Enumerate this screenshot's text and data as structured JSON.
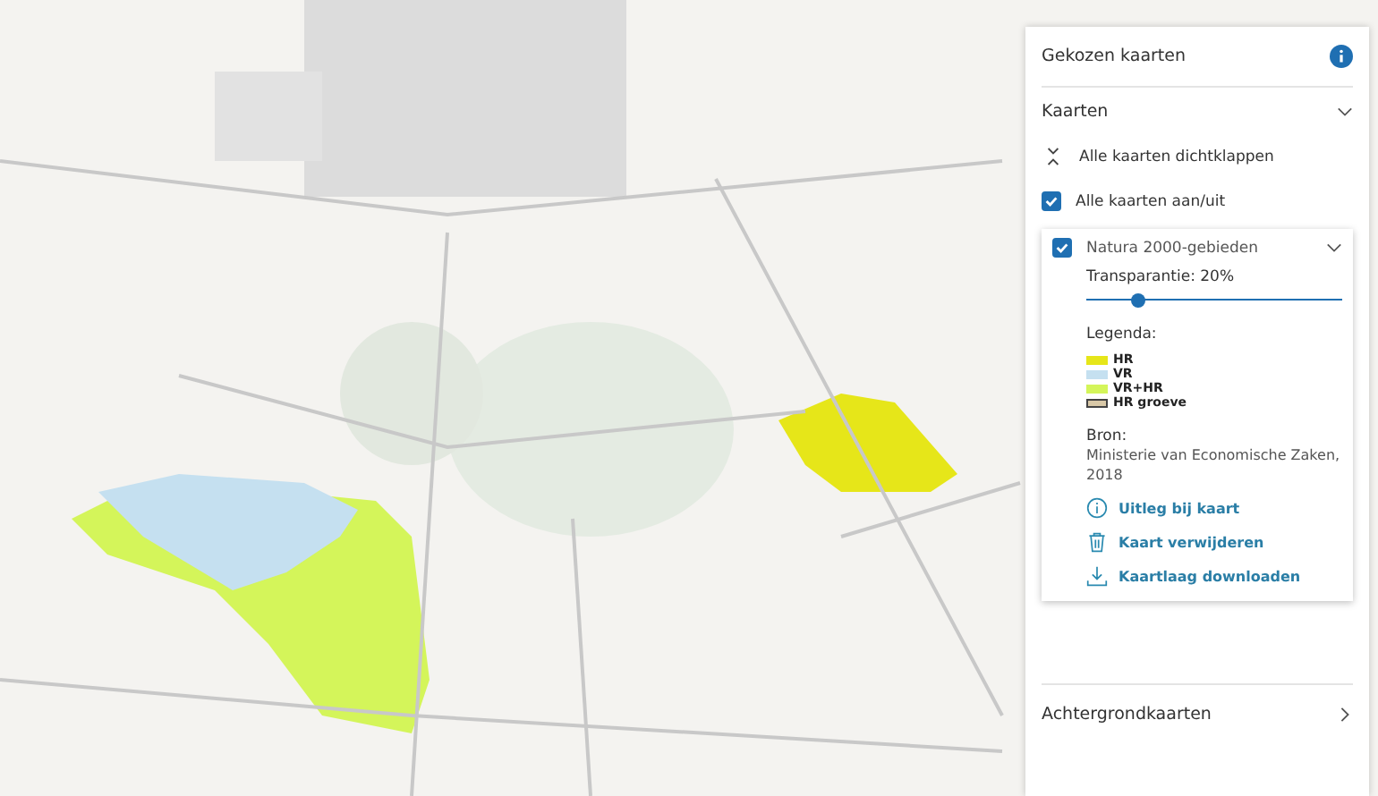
{
  "panel": {
    "title": "Gekozen kaarten",
    "maps_section": {
      "title": "Kaarten",
      "expanded": true,
      "collapse_all": "Alle kaarten dichtklappen",
      "toggle_all": {
        "label": "Alle kaarten aan/uit",
        "checked": true
      },
      "layers": [
        {
          "name": "Natura 2000-gebieden",
          "checked": true,
          "expanded": true,
          "transparency": {
            "label": "Transparantie: 20%",
            "level": 0.2
          },
          "legend_title": "Legenda:",
          "legend": [
            {
              "label": "HR",
              "kind": "fill",
              "color": "#e6e619"
            },
            {
              "label": "VR",
              "kind": "fill",
              "color": "#c5e0f0"
            },
            {
              "label": "VR+HR",
              "kind": "fill",
              "color": "#d4f55a"
            },
            {
              "label": "HR groeve",
              "kind": "outline",
              "color": "#d9c9a8"
            }
          ],
          "source_title": "Bron:",
          "source": "Ministerie van Economische Zaken, 2018",
          "actions": [
            {
              "label": "Uitleg bij kaart",
              "kind": "info"
            },
            {
              "label": "Kaart verwijderen",
              "kind": "delete"
            },
            {
              "label": "Kaartlaag downloaden",
              "kind": "download"
            }
          ]
        }
      ]
    },
    "background_section": {
      "title": "Achtergrondkaarten",
      "expanded": false
    }
  }
}
